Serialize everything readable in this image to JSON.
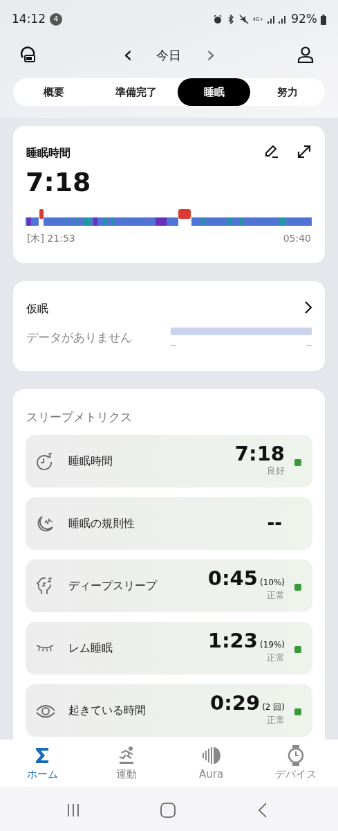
{
  "status_bar": {
    "time": "14:12",
    "notification_count": "4",
    "network": "4G+",
    "battery": "92%"
  },
  "header": {
    "title": "今日",
    "prev": "‹",
    "next": "›"
  },
  "tabs": [
    {
      "label": "概要",
      "selected": false
    },
    {
      "label": "準備完了",
      "selected": false
    },
    {
      "label": "睡眠",
      "selected": true
    },
    {
      "label": "努力",
      "selected": false
    }
  ],
  "sleep_card": {
    "title": "睡眠時間",
    "duration": "7:18",
    "start": "[木] 21:53",
    "end": "05:40"
  },
  "nap_card": {
    "title": "仮眠",
    "empty_text": "データがありません",
    "start": "--",
    "end": "--"
  },
  "metrics": {
    "title": "スリープメトリクス",
    "items": [
      {
        "kind": "clock",
        "label": "睡眠時間",
        "value": "7:18",
        "rating": "良好",
        "dot": true
      },
      {
        "kind": "moon",
        "label": "睡眠の規則性",
        "value": "--",
        "dot": false
      },
      {
        "kind": "head",
        "label": "ディープスリープ",
        "value": "0:45",
        "extra": "(10%)",
        "rating": "正常",
        "dot": true
      },
      {
        "kind": "eye-closed",
        "label": "レム睡眠",
        "value": "1:23",
        "extra": "(19%)",
        "rating": "正常",
        "dot": true
      },
      {
        "kind": "eye",
        "label": "起きている時間",
        "value": "0:29",
        "extra": "(2 回)",
        "rating": "正常",
        "dot": true
      }
    ]
  },
  "bottom_nav": [
    {
      "label": "ホーム",
      "selected": true
    },
    {
      "label": "運動",
      "selected": false
    },
    {
      "label": "Aura",
      "selected": false
    },
    {
      "label": "デバイス",
      "selected": false
    }
  ]
}
